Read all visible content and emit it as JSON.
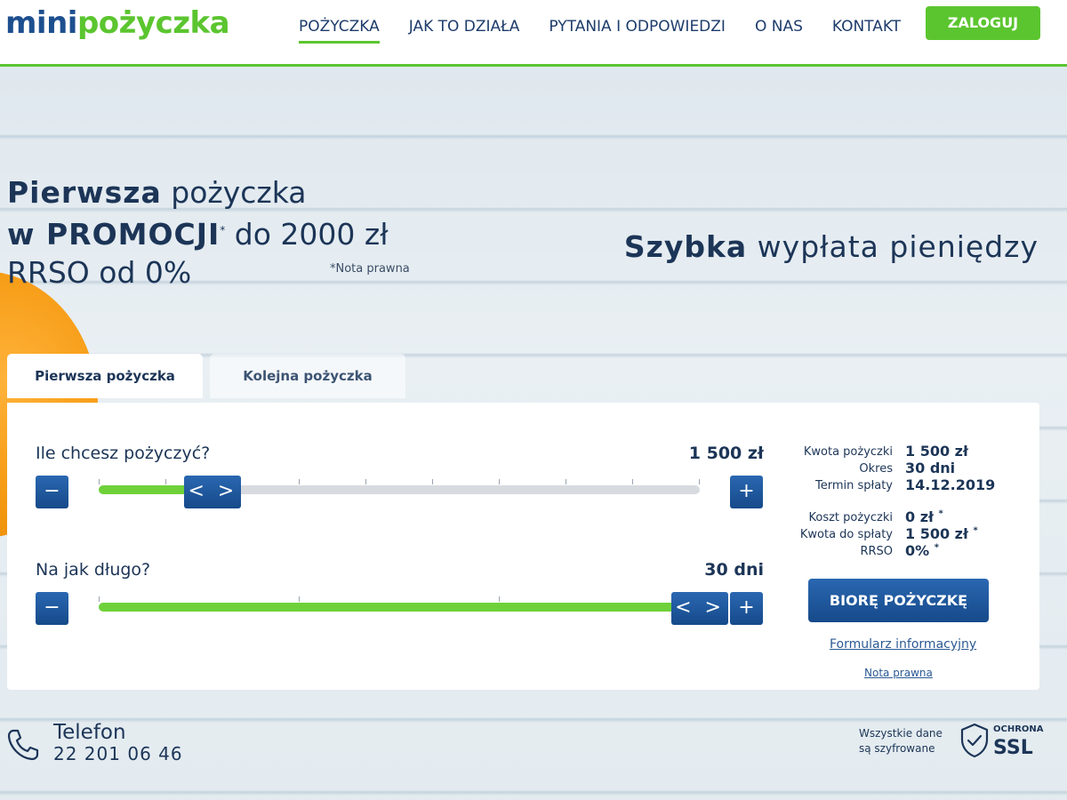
{
  "header": {
    "logo_part1": "mini",
    "logo_part2": "pożyczka",
    "nav": [
      "POŻYCZKA",
      "JAK TO DZIAŁA",
      "PYTANIA I ODPOWIEDZI",
      "O NAS",
      "KONTAKT"
    ],
    "login_label": "ZALOGUJ"
  },
  "hero": {
    "line1_bold": "Pierwsza",
    "line1_rest": " pożyczka",
    "line2_bold": "w PROMOCJI",
    "line2_star": "*",
    "line2_rest": " do 2000 zł",
    "line3": "RRSO od 0%",
    "note": "*Nota prawna",
    "tagline_bold": "Szybka",
    "tagline_rest": " wypłata pieniędzy"
  },
  "tabs": {
    "first": "Pierwsza pożyczka",
    "next": "Kolejna pożyczka"
  },
  "calculator": {
    "amount_label": "Ile chcesz pożyczyć?",
    "amount_value": "1 500 zł",
    "amount_fraction": 0.19,
    "period_label": "Na jak długo?",
    "period_value": "30 dni",
    "period_fraction": 1.0,
    "minus": "−",
    "plus": "+",
    "handle": "< >"
  },
  "summary": {
    "rows1": [
      {
        "k": "Kwota pożyczki",
        "v": "1 500 zł"
      },
      {
        "k": "Okres",
        "v": "30 dni"
      },
      {
        "k": "Termin spłaty",
        "v": "14.12.2019"
      }
    ],
    "rows2": [
      {
        "k": "Koszt pożyczki",
        "v": "0 zł",
        "star": "*"
      },
      {
        "k": "Kwota do spłaty",
        "v": "1 500 zł",
        "star": "*"
      },
      {
        "k": "RRSO",
        "v": "0%",
        "star": "*"
      }
    ],
    "cta": "BIORĘ POŻYCZKĘ",
    "link_form": "Formularz informacyjny",
    "link_note": "Nota prawna"
  },
  "footer": {
    "phone_title": "Telefon",
    "phone_number": "22 201 06 46",
    "ssl_line1": "Wszystkie dane",
    "ssl_line2": "są szyfrowane",
    "ssl_small": "OCHRONA",
    "ssl_big": "SSL"
  },
  "colors": {
    "brand_blue": "#1d4f8f",
    "brand_green": "#5bc52f",
    "slider_green": "#6fd13a"
  }
}
